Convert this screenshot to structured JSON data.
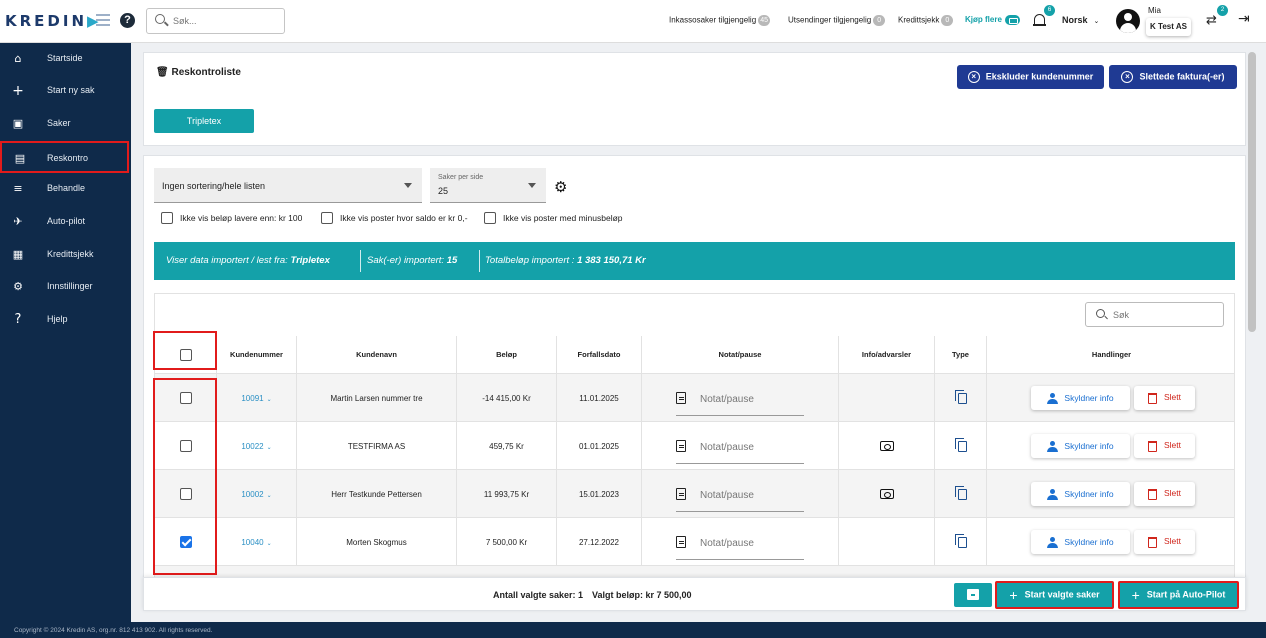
{
  "header": {
    "logo_text": "KREDIN",
    "search_placeholder": "Søk...",
    "stats": [
      {
        "label": "Inkassosaker tilgjengelig",
        "count": "45"
      },
      {
        "label": "Utsendinger tilgjengelig",
        "count": "0"
      },
      {
        "label": "Kredittsjekk",
        "count": "0"
      }
    ],
    "buy_more": "Kjøp flere",
    "notifications_count": "6",
    "language": "Norsk",
    "user_name": "Mia",
    "company": "K Test AS",
    "switch_count": "2"
  },
  "sidebar": {
    "items": [
      {
        "label": "Startside",
        "icon": "home-icon"
      },
      {
        "label": "Start ny sak",
        "icon": "plus-icon"
      },
      {
        "label": "Saker",
        "icon": "briefcase-icon"
      },
      {
        "label": "Reskontro",
        "icon": "document-icon"
      },
      {
        "label": "Behandle",
        "icon": "checklist-icon"
      },
      {
        "label": "Auto-pilot",
        "icon": "airplane-icon"
      },
      {
        "label": "Kredittsjekk",
        "icon": "id-card-icon"
      },
      {
        "label": "Innstillinger",
        "icon": "gear-icon"
      },
      {
        "label": "Hjelp",
        "icon": "question-icon"
      }
    ],
    "footer": "Copyright © 2024 Kredin AS, org.nr. 812 413 902. All rights reserved."
  },
  "panel": {
    "title": "Reskontroliste",
    "exclude_button": "Ekskluder kundenummer",
    "delete_button": "Slettede faktura(-er)",
    "source_button": "Tripletex"
  },
  "filters": {
    "sort_value": "Ingen sortering/hele listen",
    "per_page_label": "Saker per side",
    "per_page_value": "25",
    "checkboxes": [
      "Ikke vis beløp lavere enn: kr 100",
      "Ikke vis poster hvor saldo er kr 0,-",
      "Ikke vis poster med minusbeløp"
    ]
  },
  "import_info": {
    "source_label": "Viser data importert / lest fra:",
    "source_value": "Tripletex",
    "cases_label": "Sak(-er) importert:",
    "cases_value": "15",
    "total_label": "Totalbeløp importert :",
    "total_value": "1 383 150,71 Kr"
  },
  "table": {
    "search_placeholder": "Søk",
    "columns": [
      "Kundenummer",
      "Kundenavn",
      "Beløp",
      "Forfallsdato",
      "Notat/pause",
      "Info/advarsler",
      "Type",
      "Handlinger"
    ],
    "note_placeholder": "Notat/pause",
    "info_button": "Skyldner info",
    "delete_button": "Slett",
    "rows": [
      {
        "kundenr": "10091",
        "name": "Martin Larsen nummer tre",
        "amount": "-14 415,00 Kr",
        "due": "11.01.2025",
        "warning": false,
        "checked": false
      },
      {
        "kundenr": "10022",
        "name": "TESTFIRMA AS",
        "amount": "459,75 Kr",
        "due": "01.01.2025",
        "warning": true,
        "checked": false
      },
      {
        "kundenr": "10002",
        "name": "Herr Testkunde Pettersen",
        "amount": "11 993,75 Kr",
        "due": "15.01.2023",
        "warning": true,
        "checked": false
      },
      {
        "kundenr": "10040",
        "name": "Morten Skogmus",
        "amount": "7 500,00 Kr",
        "due": "27.12.2022",
        "warning": false,
        "checked": true
      }
    ]
  },
  "footer_bar": {
    "selected_count_label": "Antall valgte saker: 1",
    "selected_amount_label": "Valgt beløp: kr 7 500,00",
    "start_selected": "Start valgte saker",
    "start_autopilot": "Start på Auto-Pilot"
  }
}
